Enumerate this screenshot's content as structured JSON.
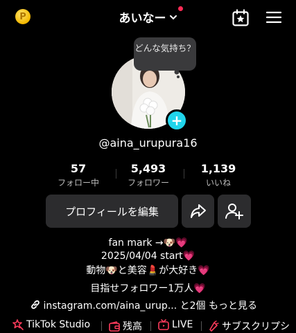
{
  "header": {
    "title": "あいなー"
  },
  "bubble": {
    "text": "どんな気持ち？"
  },
  "profile": {
    "username": "@aina_urupura16"
  },
  "stats": [
    {
      "value": "57",
      "label": "フォロー中"
    },
    {
      "value": "5,493",
      "label": "フォロワー"
    },
    {
      "value": "1,139",
      "label": "いいね"
    }
  ],
  "actions": {
    "edit_label": "プロフィールを編集"
  },
  "bio": {
    "line1": "fan mark →🐶💗",
    "line2": "2025/04/04 start💗",
    "line3": "動物🐶と美容💄が大好き💗",
    "line4": "目指せフォロワー1万人💗",
    "link": "instagram.com/aina_urup...",
    "link_more": " と2個 もっと見る"
  },
  "bottom_bar": {
    "items": [
      "TikTok Studio",
      "残高",
      "LIVE",
      "サブスクリプシ"
    ]
  },
  "colors": {
    "accent": "#20d5ec",
    "badge": "#ff2b55",
    "icon_red": "#ff3b5c"
  },
  "icons": [
    "coin-icon",
    "chevron-down-icon",
    "calendar-star-icon",
    "menu-icon",
    "share-icon",
    "add-user-icon",
    "link-icon"
  ]
}
